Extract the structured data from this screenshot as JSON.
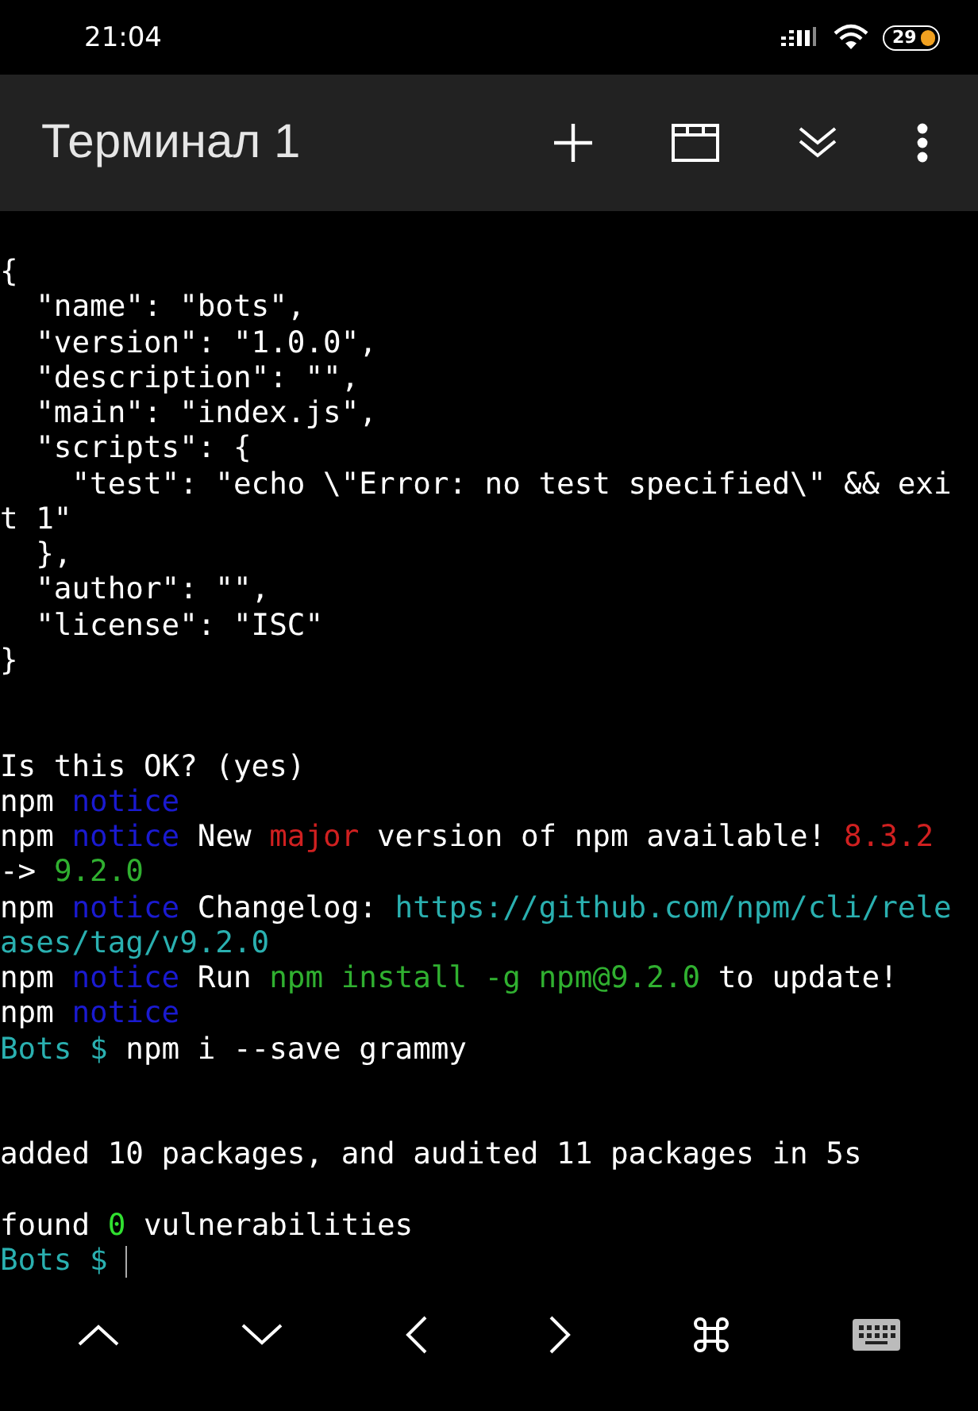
{
  "status_bar": {
    "time": "21:04",
    "battery": "29"
  },
  "toolbar": {
    "title": "Терминал 1"
  },
  "terminal": {
    "lines": [
      {
        "kind": "text",
        "segments": [
          {
            "text": "{",
            "color": "#ffffff"
          }
        ]
      },
      {
        "kind": "text",
        "segments": [
          {
            "text": "  \"name\": \"bots\",",
            "color": "#ffffff"
          }
        ]
      },
      {
        "kind": "text",
        "segments": [
          {
            "text": "  \"version\": \"1.0.0\",",
            "color": "#ffffff"
          }
        ]
      },
      {
        "kind": "text",
        "segments": [
          {
            "text": "  \"description\": \"\",",
            "color": "#ffffff"
          }
        ]
      },
      {
        "kind": "text",
        "segments": [
          {
            "text": "  \"main\": \"index.js\",",
            "color": "#ffffff"
          }
        ]
      },
      {
        "kind": "text",
        "segments": [
          {
            "text": "  \"scripts\": {",
            "color": "#ffffff"
          }
        ]
      },
      {
        "kind": "text",
        "segments": [
          {
            "text": "    \"test\": \"echo \\\"Error: no test specified\\\" && exi",
            "color": "#ffffff"
          }
        ]
      },
      {
        "kind": "text",
        "segments": [
          {
            "text": "t 1\"",
            "color": "#ffffff"
          }
        ]
      },
      {
        "kind": "text",
        "segments": [
          {
            "text": "  },",
            "color": "#ffffff"
          }
        ]
      },
      {
        "kind": "text",
        "segments": [
          {
            "text": "  \"author\": \"\",",
            "color": "#ffffff"
          }
        ]
      },
      {
        "kind": "text",
        "segments": [
          {
            "text": "  \"license\": \"ISC\"",
            "color": "#ffffff"
          }
        ]
      },
      {
        "kind": "text",
        "segments": [
          {
            "text": "}",
            "color": "#ffffff"
          }
        ]
      },
      {
        "kind": "blank"
      },
      {
        "kind": "blank"
      },
      {
        "kind": "text",
        "segments": [
          {
            "text": "Is this OK? (yes)",
            "color": "#ffffff"
          }
        ]
      },
      {
        "kind": "text",
        "segments": [
          {
            "text": "npm",
            "color": "#ffffff"
          },
          {
            "text": "notice",
            "color": "#1a1ad0"
          }
        ]
      },
      {
        "kind": "text",
        "segments": [
          {
            "text": "npm",
            "color": "#ffffff"
          },
          {
            "text": "notice",
            "color": "#1a1ad0"
          },
          {
            "text": "New",
            "color": "#ffffff"
          },
          {
            "text": "major",
            "color": "#d02020"
          },
          {
            "text": "version of npm available!",
            "color": "#ffffff"
          },
          {
            "text": "8.3.2",
            "color": "#d02020"
          }
        ]
      },
      {
        "kind": "text",
        "segments": [
          {
            "text": "->",
            "color": "#ffffff"
          },
          {
            "text": "9.2.0",
            "color": "#30b030"
          }
        ]
      },
      {
        "kind": "text",
        "segments": [
          {
            "text": "npm",
            "color": "#ffffff"
          },
          {
            "text": "notice",
            "color": "#1a1ad0"
          },
          {
            "text": "Changelog:",
            "color": "#ffffff"
          },
          {
            "text": "https://github.com/npm/cli/rele",
            "color": "#2ab0b0"
          }
        ]
      },
      {
        "kind": "text",
        "segments": [
          {
            "text": "ases/tag/v9.2.0",
            "color": "#2ab0b0"
          }
        ]
      },
      {
        "kind": "text",
        "segments": [
          {
            "text": "npm",
            "color": "#ffffff"
          },
          {
            "text": "notice",
            "color": "#1a1ad0"
          },
          {
            "text": "Run",
            "color": "#ffffff"
          },
          {
            "text": "npm install -g npm@9.2.0",
            "color": "#30b030"
          },
          {
            "text": "to update!",
            "color": "#ffffff"
          }
        ]
      },
      {
        "kind": "text",
        "segments": [
          {
            "text": "npm",
            "color": "#ffffff"
          },
          {
            "text": "notice",
            "color": "#1a1ad0"
          }
        ]
      },
      {
        "kind": "text",
        "segments": [
          {
            "text": "Bots $",
            "color": "#2ab0b0"
          },
          {
            "text": "npm i --save grammy",
            "color": "#ffffff"
          }
        ]
      },
      {
        "kind": "blank"
      },
      {
        "kind": "blank"
      },
      {
        "kind": "text",
        "segments": [
          {
            "text": "added 10 packages, and audited 11 packages in 5s",
            "color": "#ffffff"
          }
        ]
      },
      {
        "kind": "blank"
      },
      {
        "kind": "text",
        "segments": [
          {
            "text": "found",
            "color": "#ffffff"
          },
          {
            "text": "0",
            "color": "#30e030"
          },
          {
            "text": "vulnerabilities",
            "color": "#ffffff"
          }
        ]
      },
      {
        "kind": "prompt",
        "segments": [
          {
            "text": "Bots $",
            "color": "#2ab0b0"
          }
        ]
      }
    ]
  }
}
